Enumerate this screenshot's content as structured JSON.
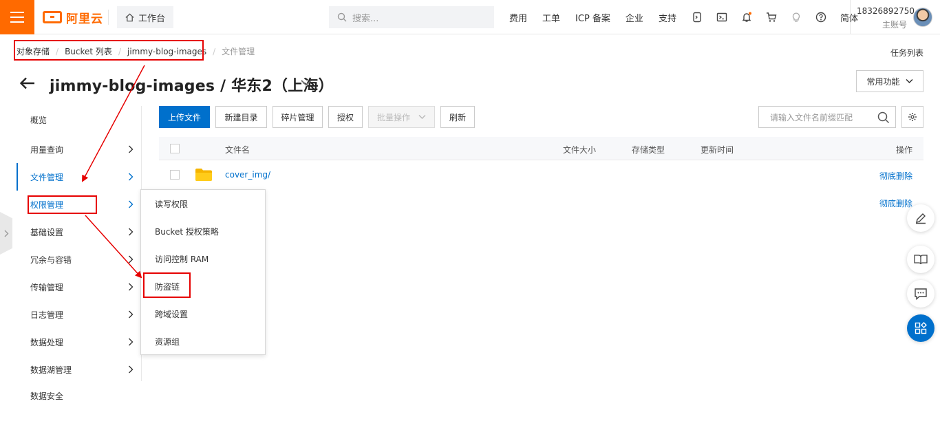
{
  "header": {
    "logo_text": "阿里云",
    "workbench": "工作台",
    "search_placeholder": "搜索...",
    "nav_links": [
      "费用",
      "工单",
      "ICP 备案",
      "企业",
      "支持"
    ],
    "lang": "简体",
    "user_phone": "18326892750",
    "user_role": "主账号"
  },
  "breadcrumb": [
    "对象存储",
    "Bucket 列表",
    "jimmy-blog-images",
    "文件管理"
  ],
  "task_list": "任务列表",
  "page": {
    "title": "jimmy-blog-images / 华东2（上海）",
    "common_functions": "常用功能"
  },
  "sidebar": {
    "items": [
      "概览",
      "用量查询",
      "文件管理",
      "权限管理",
      "基础设置",
      "冗余与容错",
      "传输管理",
      "日志管理",
      "数据处理",
      "数据湖管理",
      "数据安全"
    ]
  },
  "submenu": {
    "items": [
      "读写权限",
      "Bucket 授权策略",
      "访问控制 RAM",
      "防盗链",
      "跨域设置",
      "资源组"
    ]
  },
  "toolbar": {
    "upload": "上传文件",
    "new_dir": "新建目录",
    "fragments": "碎片管理",
    "authorize": "授权",
    "batch": "批量操作",
    "refresh": "刷新",
    "search_placeholder": "请输入文件名前缀匹配"
  },
  "table": {
    "columns": [
      "文件名",
      "文件大小",
      "存储类型",
      "更新时间",
      "操作"
    ],
    "rows": [
      {
        "name": "cover_img/",
        "action": "彻底删除"
      },
      {
        "name": "",
        "action": "彻底删除"
      }
    ]
  },
  "colors": {
    "brand_orange": "#ff6a00",
    "primary_blue": "#0070cc",
    "annotation_red": "#e60000"
  }
}
